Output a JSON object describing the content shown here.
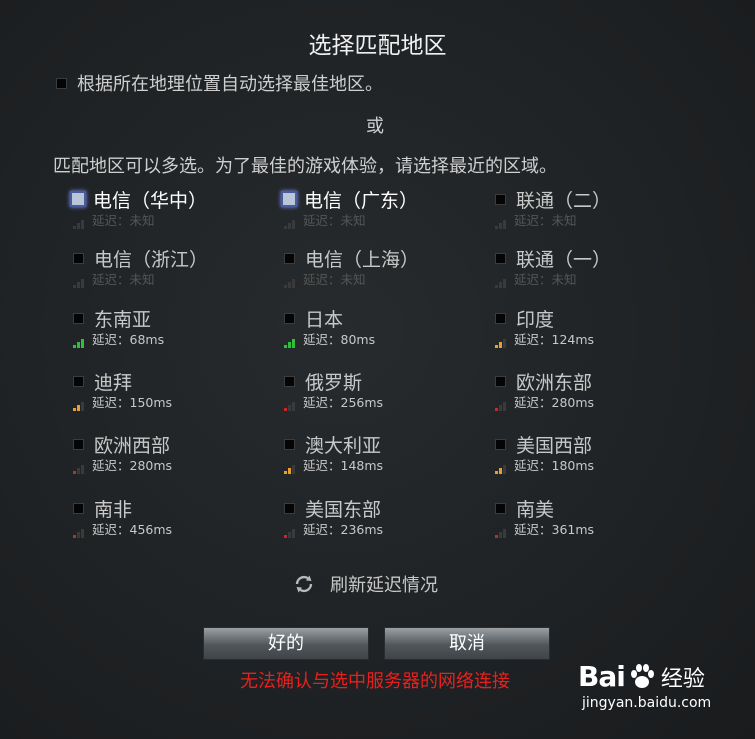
{
  "title": "选择匹配地区",
  "auto_select": {
    "label": "根据所在地理位置自动选择最佳地区。",
    "checked": false
  },
  "or_text": "或",
  "description": "匹配地区可以多选。为了最佳的游戏体验，请选择最近的区域。",
  "colors": {
    "good": "#2fbf3a",
    "medium": "#e8a02a",
    "bad": "#c8282a",
    "unknown": "#3a3a3a"
  },
  "regions": [
    {
      "name": "电信（华中）",
      "latency": "延迟：未知",
      "checked": true,
      "signal": "unknown"
    },
    {
      "name": "电信（广东）",
      "latency": "延迟：未知",
      "checked": true,
      "signal": "unknown"
    },
    {
      "name": "联通（二）",
      "latency": "延迟：未知",
      "checked": false,
      "signal": "unknown"
    },
    {
      "name": "电信（浙江）",
      "latency": "延迟：未知",
      "checked": false,
      "signal": "unknown"
    },
    {
      "name": "电信（上海）",
      "latency": "延迟：未知",
      "checked": false,
      "signal": "unknown"
    },
    {
      "name": "联通（一）",
      "latency": "延迟：未知",
      "checked": false,
      "signal": "unknown"
    },
    {
      "name": "东南亚",
      "latency": "延迟：68ms",
      "checked": false,
      "signal": "good"
    },
    {
      "name": "日本",
      "latency": "延迟：80ms",
      "checked": false,
      "signal": "good"
    },
    {
      "name": "印度",
      "latency": "延迟：124ms",
      "checked": false,
      "signal": "medium"
    },
    {
      "name": "迪拜",
      "latency": "延迟：150ms",
      "checked": false,
      "signal": "medium"
    },
    {
      "name": "俄罗斯",
      "latency": "延迟：256ms",
      "checked": false,
      "signal": "bad"
    },
    {
      "name": "欧洲东部",
      "latency": "延迟：280ms",
      "checked": false,
      "signal": "bad"
    },
    {
      "name": "欧洲西部",
      "latency": "延迟：280ms",
      "checked": false,
      "signal": "bad"
    },
    {
      "name": "澳大利亚",
      "latency": "延迟：148ms",
      "checked": false,
      "signal": "medium"
    },
    {
      "name": "美国西部",
      "latency": "延迟：180ms",
      "checked": false,
      "signal": "medium"
    },
    {
      "name": "南非",
      "latency": "延迟：456ms",
      "checked": false,
      "signal": "bad"
    },
    {
      "name": "美国东部",
      "latency": "延迟：236ms",
      "checked": false,
      "signal": "bad"
    },
    {
      "name": "南美",
      "latency": "延迟：361ms",
      "checked": false,
      "signal": "bad"
    }
  ],
  "refresh_label": "刷新延迟情况",
  "buttons": {
    "ok": "好的",
    "cancel": "取消"
  },
  "error_message": "无法确认与选中服务器的网络连接",
  "watermark": {
    "brand": "Bai",
    "brand_cn": "经验",
    "url": "jingyan.baidu.com"
  }
}
